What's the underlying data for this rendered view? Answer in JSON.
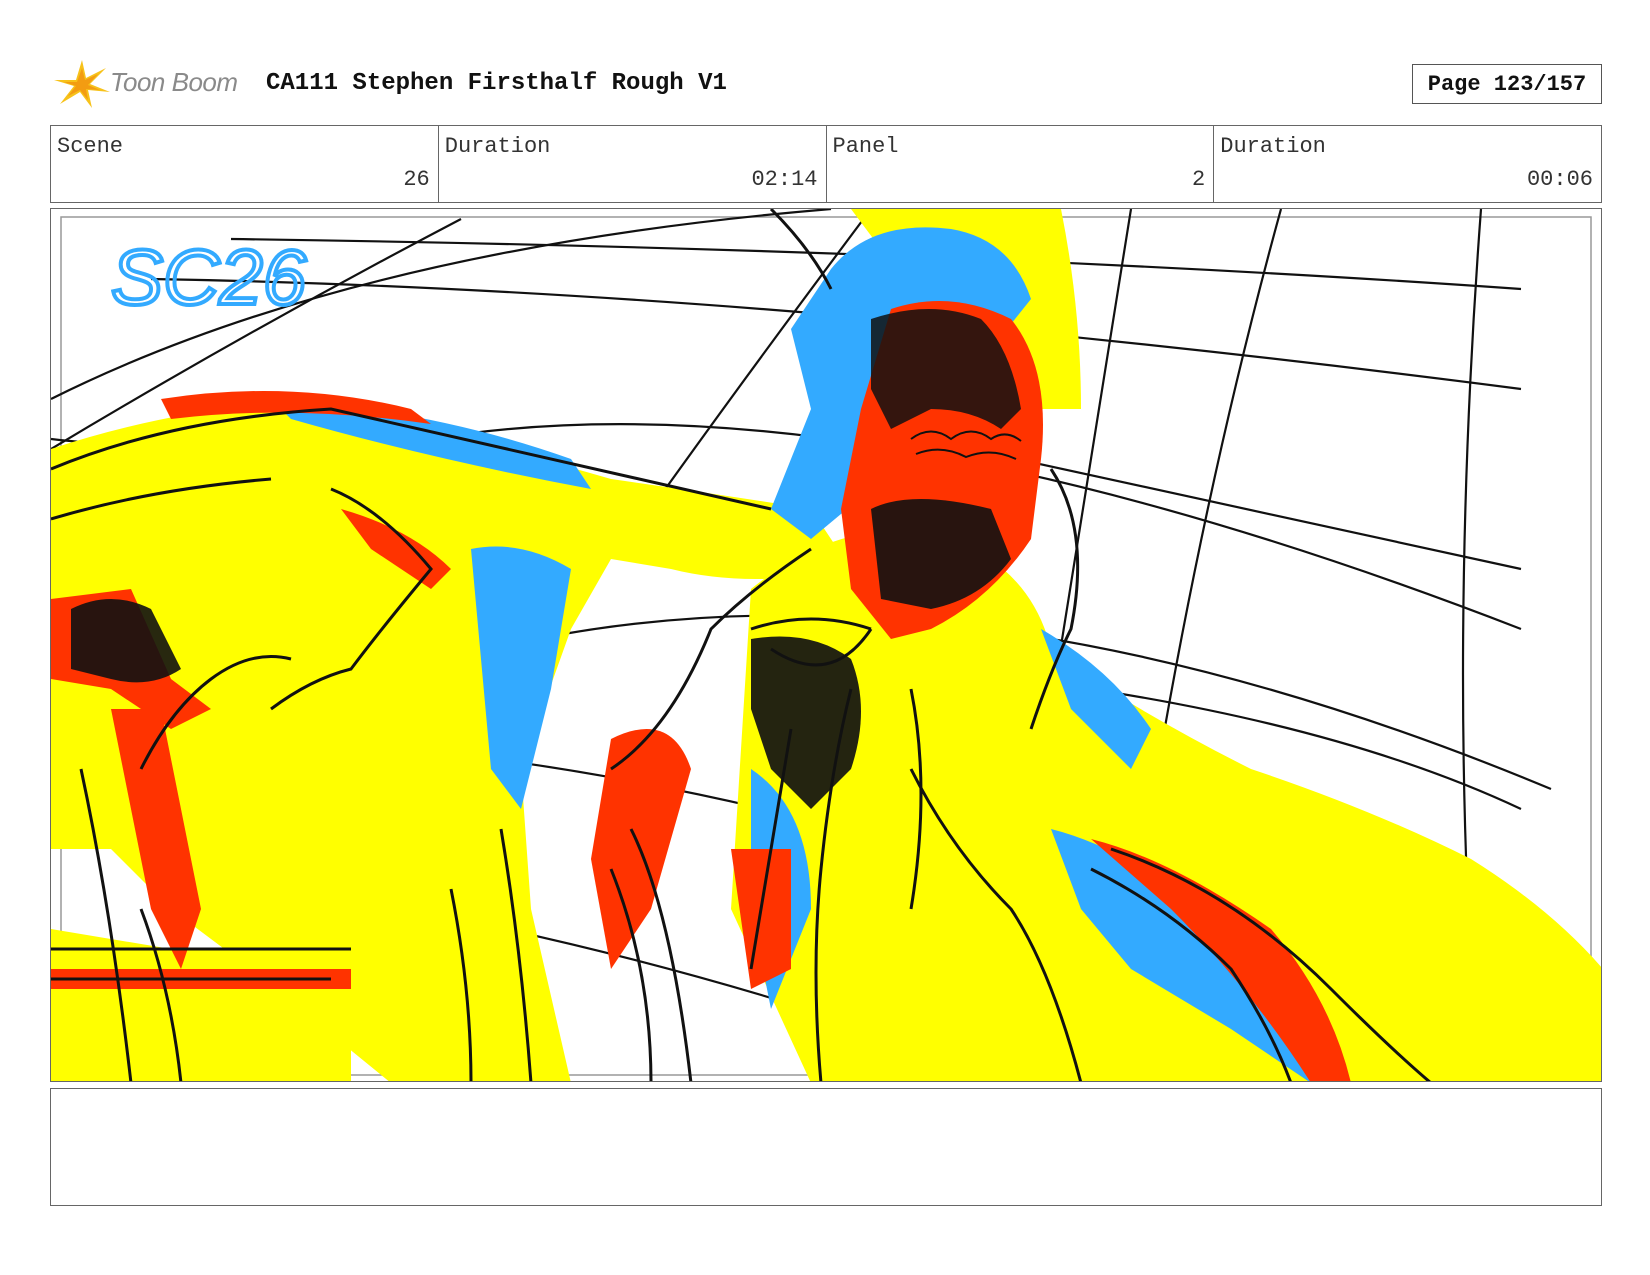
{
  "header": {
    "logo_text": "Toon Boom",
    "title": "CA111 Stephen Firsthalf Rough V1",
    "page_label": "Page 123/157"
  },
  "info": {
    "scene_label": "Scene",
    "scene_value": "26",
    "scene_duration_label": "Duration",
    "scene_duration_value": "02:14",
    "panel_label": "Panel",
    "panel_value": "2",
    "panel_duration_label": "Duration",
    "panel_duration_value": "00:06"
  },
  "sketch": {
    "scene_note": "SC26",
    "colors": {
      "yellow": "#ffff00",
      "red": "#ff3300",
      "blue": "#33aaff",
      "black": "#111111"
    }
  },
  "notes": {
    "text": ""
  }
}
